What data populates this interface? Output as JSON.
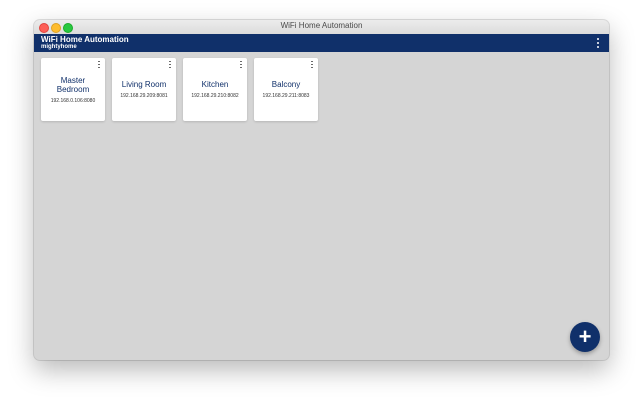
{
  "window": {
    "title": "WiFi Home Automation"
  },
  "appbar": {
    "title": "WiFi Home Automation",
    "subtitle": "mightyhome",
    "menu_icon": "more-vert-icon"
  },
  "devices": [
    {
      "name": "Master Bedroom",
      "address": "192.168.0.106:8080"
    },
    {
      "name": "Living Room",
      "address": "192.168.29.209:8081"
    },
    {
      "name": "Kitchen",
      "address": "192.168.29.210:8082"
    },
    {
      "name": "Balcony",
      "address": "192.168.29.211:8083"
    }
  ],
  "fab": {
    "icon": "plus-icon",
    "label": "+"
  },
  "colors": {
    "primary": "#10306a",
    "background": "#d5d5d5",
    "card": "#ffffff"
  }
}
